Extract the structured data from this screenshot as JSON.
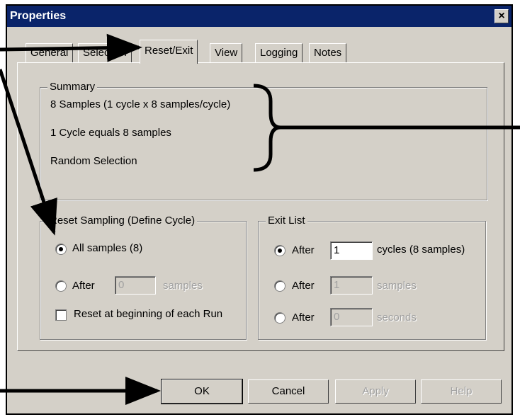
{
  "window": {
    "title": "Properties",
    "close_glyph": "×"
  },
  "tabs": [
    "General",
    "Selection",
    "Reset/Exit",
    "View",
    "Logging",
    "Notes"
  ],
  "active_tab": "Reset/Exit",
  "summary": {
    "legend": "Summary",
    "lines": [
      "8 Samples (1 cycle x 8 samples/cycle)",
      "1 Cycle equals 8 samples",
      "Random Selection"
    ]
  },
  "reset_sampling": {
    "legend": "Reset Sampling (Define Cycle)",
    "all_samples_label": "All samples (8)",
    "after_label": "After",
    "after_value": "0",
    "after_unit": "samples",
    "reset_each_run_label": "Reset at beginning of each Run"
  },
  "exit_list": {
    "legend": "Exit List",
    "rows": [
      {
        "label": "After",
        "value": "1",
        "unit": "cycles (8 samples)"
      },
      {
        "label": "After",
        "value": "1",
        "unit": "samples"
      },
      {
        "label": "After",
        "value": "0",
        "unit": "seconds"
      }
    ]
  },
  "buttons": {
    "ok": "OK",
    "cancel": "Cancel",
    "apply": "Apply",
    "help": "Help"
  },
  "colors": {
    "title_bar": "#0a246a",
    "face": "#d4d0c8",
    "annotation": "#000000"
  }
}
